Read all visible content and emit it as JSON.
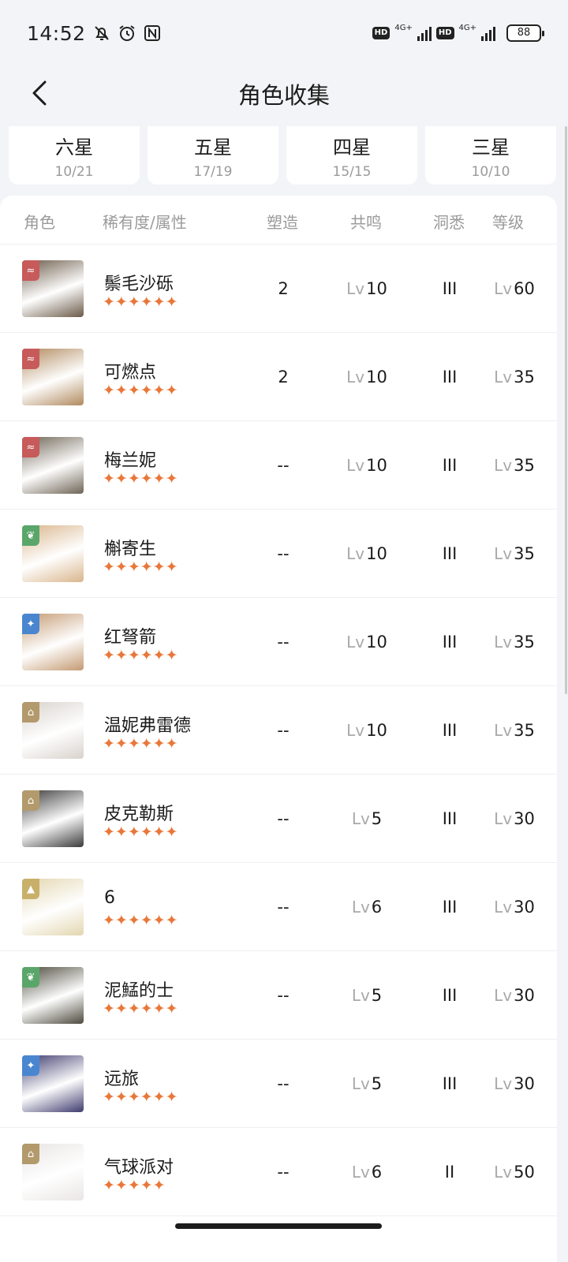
{
  "status": {
    "time": "14:52",
    "battery": "88",
    "network_1": "4G+",
    "network_2": "4G+",
    "hd": "HD",
    "icons": [
      "mute-bell-icon",
      "alarm-icon",
      "nfc-icon"
    ]
  },
  "header": {
    "title": "角色收集",
    "back_icon": "chevron-left-icon"
  },
  "tabs": [
    {
      "label": "六星",
      "count": "10/21"
    },
    {
      "label": "五星",
      "count": "17/19"
    },
    {
      "label": "四星",
      "count": "15/15"
    },
    {
      "label": "三星",
      "count": "10/10"
    }
  ],
  "columns": {
    "role": "角色",
    "rarity": "稀有度/属性",
    "shaping": "塑造",
    "resonance": "共鸣",
    "insight": "洞悉",
    "level": "等级"
  },
  "lv_prefix": "Lv",
  "rows": [
    {
      "name": "鬃毛沙砾",
      "stars": "✦✦✦✦✦✦",
      "shaping": "2",
      "resonance": "10",
      "insight": "III",
      "level": "60",
      "attr": "beast-icon",
      "attr_color": "#c75a5a",
      "avatar_color": "#6b5a48"
    },
    {
      "name": "可燃点",
      "stars": "✦✦✦✦✦✦",
      "shaping": "2",
      "resonance": "10",
      "insight": "III",
      "level": "35",
      "attr": "beast-icon",
      "attr_color": "#c75a5a",
      "avatar_color": "#b08a5e"
    },
    {
      "name": "梅兰妮",
      "stars": "✦✦✦✦✦✦",
      "shaping": "--",
      "resonance": "10",
      "insight": "III",
      "level": "35",
      "attr": "beast-icon",
      "attr_color": "#c75a5a",
      "avatar_color": "#6e6455"
    },
    {
      "name": "槲寄生",
      "stars": "✦✦✦✦✦✦",
      "shaping": "--",
      "resonance": "10",
      "insight": "III",
      "level": "35",
      "attr": "plant-icon",
      "attr_color": "#5aa66a",
      "avatar_color": "#d9b58c"
    },
    {
      "name": "红弩箭",
      "stars": "✦✦✦✦✦✦",
      "shaping": "--",
      "resonance": "10",
      "insight": "III",
      "level": "35",
      "attr": "star-icon",
      "attr_color": "#4a86d0",
      "avatar_color": "#c49a72"
    },
    {
      "name": "温妮弗雷德",
      "stars": "✦✦✦✦✦✦",
      "shaping": "--",
      "resonance": "10",
      "insight": "III",
      "level": "35",
      "attr": "mineral-icon",
      "attr_color": "#b39a6c",
      "avatar_color": "#d8d2cc"
    },
    {
      "name": "皮克勒斯",
      "stars": "✦✦✦✦✦✦",
      "shaping": "--",
      "resonance": "5",
      "insight": "III",
      "level": "30",
      "attr": "mineral-icon",
      "attr_color": "#b39a6c",
      "avatar_color": "#3a3a3a"
    },
    {
      "name": "6",
      "stars": "✦✦✦✦✦✦",
      "shaping": "--",
      "resonance": "6",
      "insight": "III",
      "level": "30",
      "attr": "spirit-icon",
      "attr_color": "#c9b06a",
      "avatar_color": "#e3d6b0"
    },
    {
      "name": "泥鯭的士",
      "stars": "✦✦✦✦✦✦",
      "shaping": "--",
      "resonance": "5",
      "insight": "III",
      "level": "30",
      "attr": "plant-icon",
      "attr_color": "#5aa66a",
      "avatar_color": "#4c4a3c"
    },
    {
      "name": "远旅",
      "stars": "✦✦✦✦✦✦",
      "shaping": "--",
      "resonance": "5",
      "insight": "III",
      "level": "30",
      "attr": "star-icon",
      "attr_color": "#4a86d0",
      "avatar_color": "#3e3b6e"
    },
    {
      "name": "气球派对",
      "stars": "✦✦✦✦✦",
      "shaping": "--",
      "resonance": "6",
      "insight": "II",
      "level": "50",
      "attr": "mineral-icon",
      "attr_color": "#b39a6c",
      "avatar_color": "#e9e6e4"
    }
  ]
}
